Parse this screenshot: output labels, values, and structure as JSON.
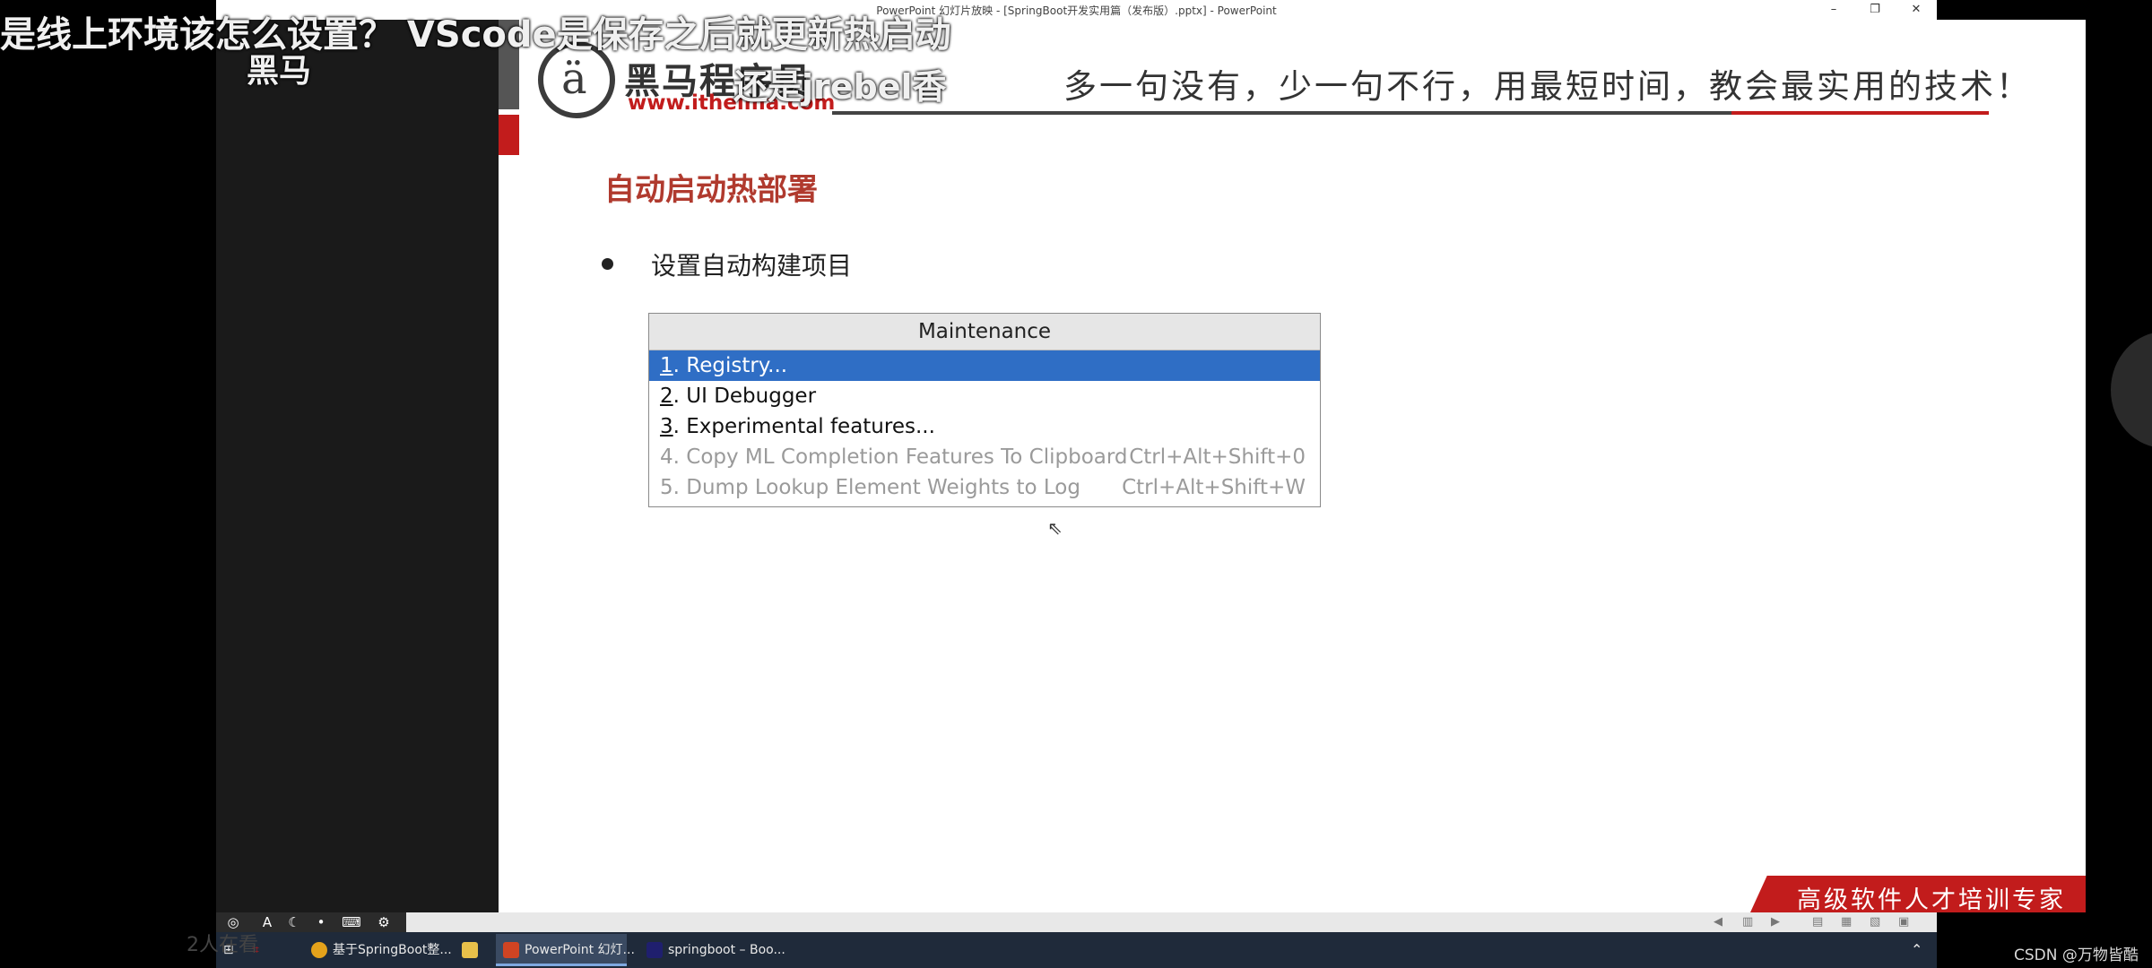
{
  "window": {
    "title": "PowerPoint 幻灯片放映 - [SpringBoot开发实用篇（发布版）.pptx] - PowerPoint",
    "min_icon": "minimize-icon",
    "restore_icon": "restore-icon",
    "close_icon": "close-icon"
  },
  "slide": {
    "logo_text": "黑马程序员",
    "logo_url": "www.itheima.com",
    "slogan": "多一句没有，少一句不行，用最短时间，教会最实用的技术！",
    "title": "自动启动热部署",
    "bullet": "设置自动构建项目",
    "footer": "高级软件人才培训专家",
    "accent_color": "#c21c1c"
  },
  "maintenance": {
    "header": "Maintenance",
    "items": [
      {
        "num": "1",
        "label": ". Registry...",
        "shortcut": "",
        "selected": true,
        "disabled": false
      },
      {
        "num": "2",
        "label": ". UI Debugger",
        "shortcut": "",
        "selected": false,
        "disabled": false
      },
      {
        "num": "3",
        "label": ". Experimental features...",
        "shortcut": "",
        "selected": false,
        "disabled": false
      },
      {
        "num": "4",
        "label": ". Copy ML Completion Features To Clipboard",
        "shortcut": "Ctrl+Alt+Shift+0",
        "selected": false,
        "disabled": true
      },
      {
        "num": "5",
        "label": ". Dump Lookup Element Weights to Log",
        "shortcut": "Ctrl+Alt+Shift+W",
        "selected": false,
        "disabled": true
      }
    ]
  },
  "taskbar": {
    "items": [
      {
        "label": "基于SpringBoot整...",
        "icon": "chrome-icon"
      },
      {
        "label": "",
        "icon": "file-explorer-icon"
      },
      {
        "label": "PowerPoint 幻灯...",
        "icon": "powerpoint-icon"
      },
      {
        "label": "springboot – Boo...",
        "icon": "intellij-icon"
      }
    ]
  },
  "overlay": {
    "danmaku_1": "是线上环境该怎么设置？ VScode是保存之后就更新热启动",
    "danmaku_2": "黑马",
    "danmaku_3": "还是jrebel香",
    "live_count": "2人在看",
    "watermark": "CSDN @万物皆酷"
  }
}
